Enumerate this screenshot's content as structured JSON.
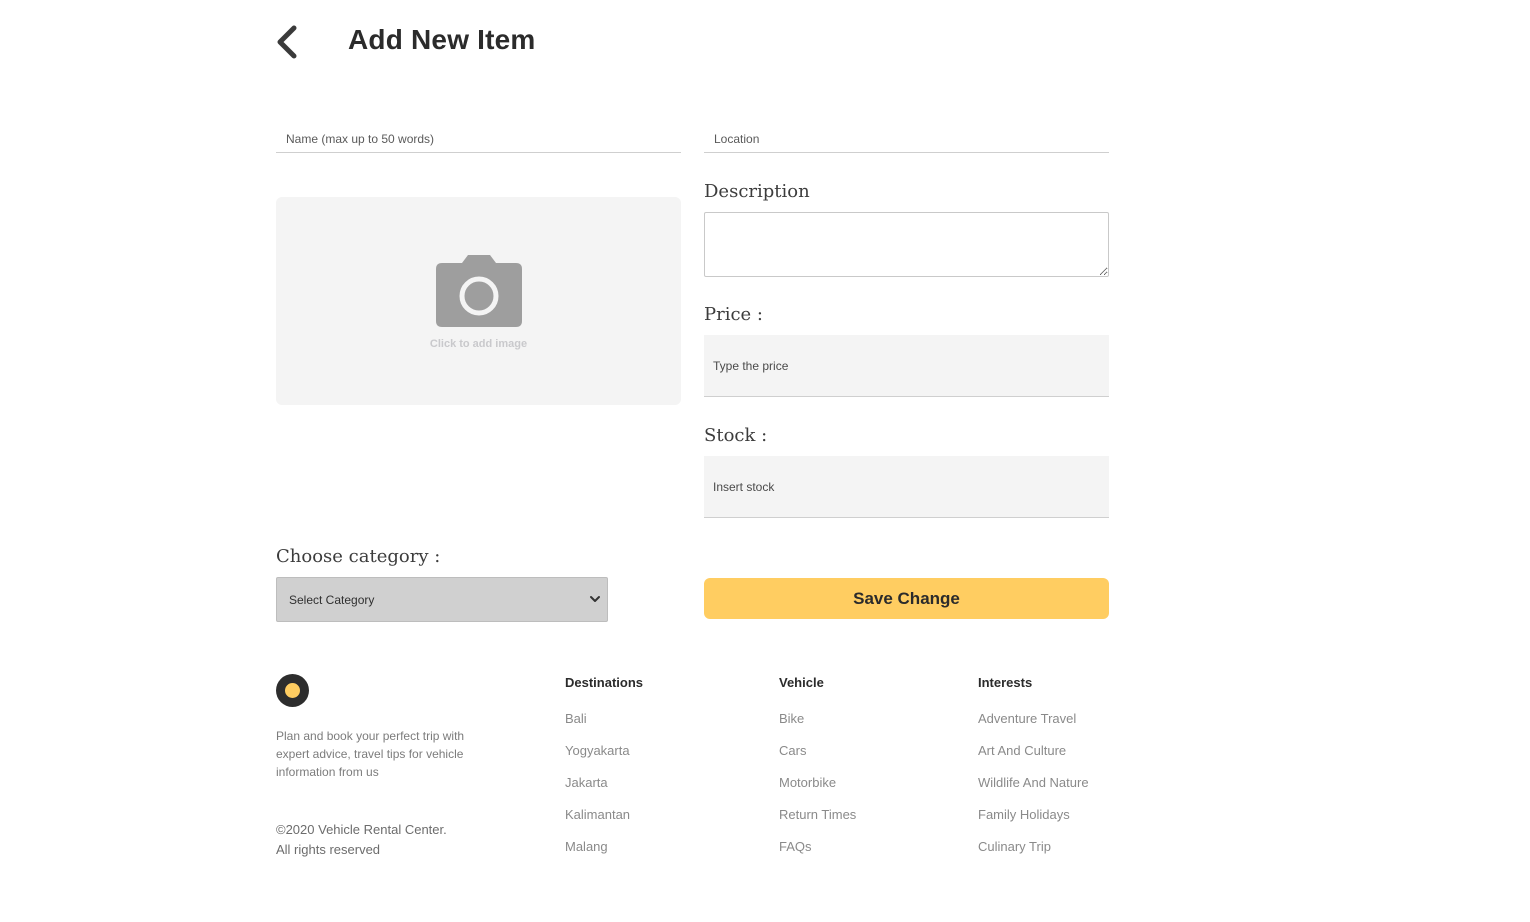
{
  "header": {
    "back_icon": "chevron-left-icon",
    "title": "Add New Item"
  },
  "form": {
    "name_placeholder": "Name (max up to 50 words)",
    "location_placeholder": "Location",
    "image_icon": "camera-icon",
    "image_hint": "Click to add image",
    "description_label": "Description",
    "description_value": "",
    "price_label": "Price :",
    "price_placeholder": "Type the price",
    "stock_label": "Stock :",
    "stock_placeholder": "Insert stock",
    "category_label": "Choose category :",
    "category_selected": "Select Category",
    "save_label": "Save Change"
  },
  "footer": {
    "description": "Plan and book your perfect trip with expert advice, travel tips for vehicle information from us",
    "copyright_line1": "©2020 Vehicle Rental Center.",
    "copyright_line2": "All rights reserved",
    "columns": [
      {
        "title": "Destinations",
        "items": [
          "Bali",
          "Yogyakarta",
          "Jakarta",
          "Kalimantan",
          "Malang"
        ]
      },
      {
        "title": "Vehicle",
        "items": [
          "Bike",
          "Cars",
          "Motorbike",
          "Return Times",
          "FAQs"
        ]
      },
      {
        "title": "Interests",
        "items": [
          "Adventure Travel",
          "Art And Culture",
          "Wildlife And Nature",
          "Family Holidays",
          "Culinary Trip"
        ]
      }
    ]
  },
  "colors": {
    "accent": "#ffcd61",
    "input_bg": "#f4f4f4",
    "select_bg": "#d0d0d0",
    "text_dark": "#2b2b2b"
  }
}
